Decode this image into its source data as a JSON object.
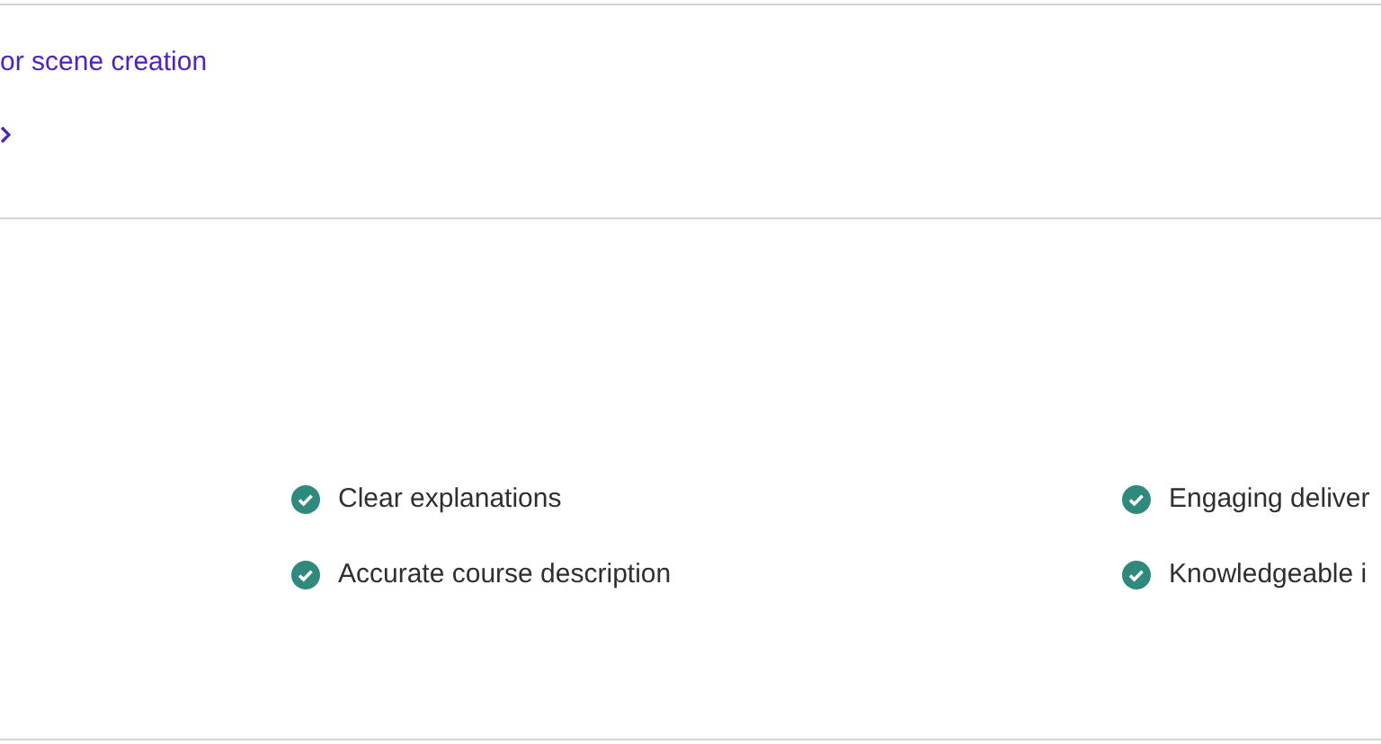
{
  "link_card": {
    "title": "or scene creation"
  },
  "highlights": [
    {
      "label": "Clear explanations"
    },
    {
      "label": "Engaging deliver"
    },
    {
      "label": "Accurate course description"
    },
    {
      "label": "Knowledgeable i"
    }
  ]
}
